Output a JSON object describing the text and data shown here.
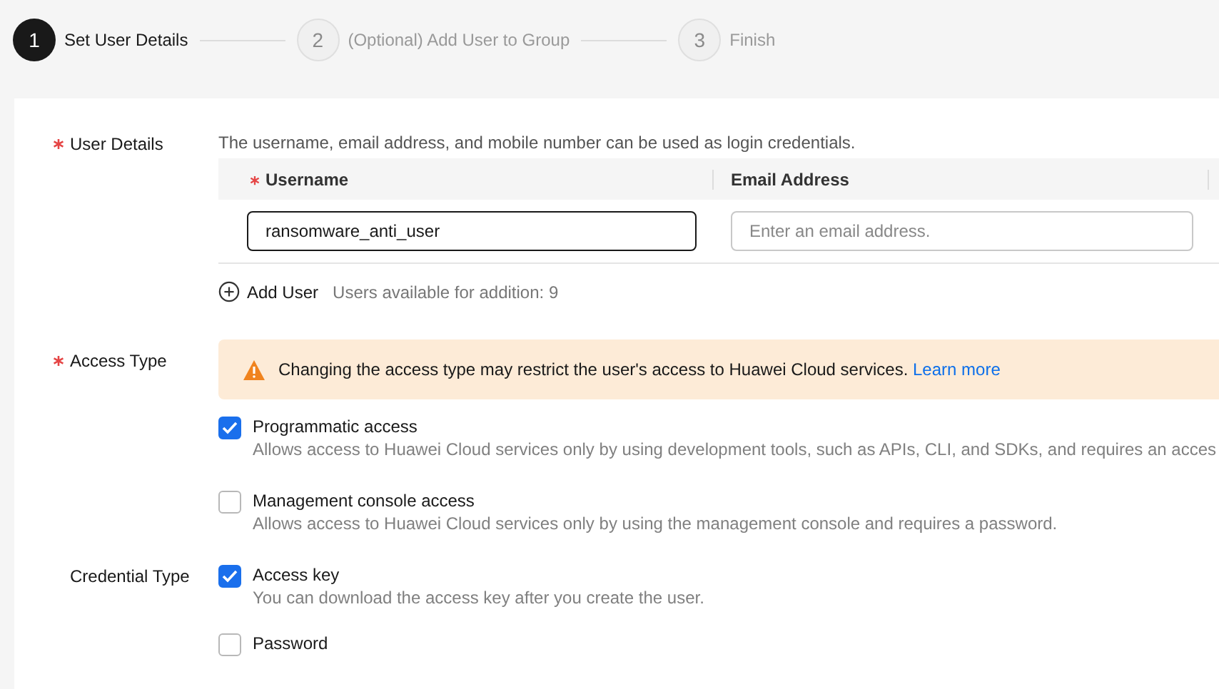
{
  "steps": [
    {
      "number": "1",
      "label": "Set User Details",
      "active": true
    },
    {
      "number": "2",
      "label": "(Optional) Add User to Group",
      "active": false
    },
    {
      "number": "3",
      "label": "Finish",
      "active": false
    }
  ],
  "user_details": {
    "label": "User Details",
    "required": true,
    "hint": "The username, email address, and mobile number can be used as login credentials.",
    "columns": [
      {
        "label": "Username",
        "required": true
      },
      {
        "label": "Email Address",
        "required": false
      }
    ],
    "rows": [
      {
        "username": {
          "value": "ransomware_anti_user",
          "focused": true
        },
        "email": {
          "placeholder": "Enter an email address."
        }
      }
    ],
    "add_user": "Add User",
    "available": "Users available for addition: 9"
  },
  "access_type": {
    "label": "Access Type",
    "required": true,
    "alert": {
      "text": "Changing the access type may restrict the user's access to Huawei Cloud services.",
      "link": "Learn more"
    },
    "options": [
      {
        "label": "Programmatic access",
        "description": "Allows access to Huawei Cloud services only by using development tools, such as APIs, CLI, and SDKs, and requires an acces",
        "checked": true
      },
      {
        "label": "Management console access",
        "description": "Allows access to Huawei Cloud services only by using the management console and requires a password.",
        "checked": false
      }
    ]
  },
  "credential_type": {
    "label": "Credential Type",
    "options": [
      {
        "label": "Access key",
        "description": "You can download the access key after you create the user.",
        "checked": true
      },
      {
        "label": "Password",
        "checked": false
      }
    ]
  }
}
